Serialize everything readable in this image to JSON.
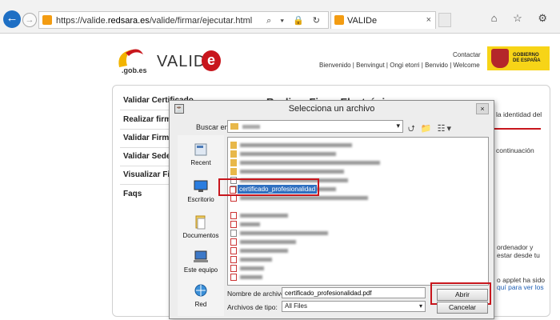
{
  "browser": {
    "url_prefix": "https://valide.",
    "url_domain": "redsara.es",
    "url_path": "/valide/firmar/ejecutar.html",
    "address_tools": "⌕ ▾ 🔒 ↻",
    "tab_title": "VALIDe",
    "tab_close": "×",
    "window_icons": "⌂ ☆ ⚙"
  },
  "site": {
    "logo_gob": ".gob.es",
    "logo_text": "VALID",
    "logo_e": "e",
    "contact": "Contactar",
    "languages": "Bienvenido  |  Benvingut  |  Ongi etorri  |  Benvido  |  Welcome",
    "gov_label": "GOBIERNO\nDE ESPAÑA"
  },
  "sidebar": {
    "items": [
      {
        "label": "Validar Certificado"
      },
      {
        "label": "Realizar firm"
      },
      {
        "label": "Validar Firma"
      },
      {
        "label": "Validar Sede"
      },
      {
        "label": "Visualizar Fir"
      },
      {
        "label": "Faqs"
      }
    ]
  },
  "main": {
    "title": "Realizar Firma Electrónica",
    "right_1": "la identidad del",
    "right_2": "continuación",
    "right_3": "ordenador y",
    "right_4": "estar desde tu",
    "right_5": "o applet ha sido",
    "right_6": "quí para ver los"
  },
  "dialog": {
    "title": "Selecciona un archivo",
    "close": "×",
    "buscar_label": "Buscar en:",
    "toolbar_icons": "⮍ 📁 ☷▾",
    "places": [
      {
        "label": "Recent",
        "icon": "recent-icon"
      },
      {
        "label": "Escritorio",
        "icon": "desktop-icon"
      },
      {
        "label": "Documentos",
        "icon": "documents-icon"
      },
      {
        "label": "Este equipo",
        "icon": "computer-icon"
      },
      {
        "label": "Red",
        "icon": "network-icon"
      }
    ],
    "selected_file": "certificado_profesionalidad",
    "filename_label": "Nombre de archivo:",
    "filename_value": "certificado_profesionalidad.pdf",
    "filetype_label": "Archivos de tipo:",
    "filetype_value": "All Files",
    "open_button": "Abrir",
    "cancel_button": "Cancelar"
  },
  "colors": {
    "accent_red": "#c8161d",
    "selection_blue": "#3070c0",
    "back_button": "#1e6fc4"
  }
}
